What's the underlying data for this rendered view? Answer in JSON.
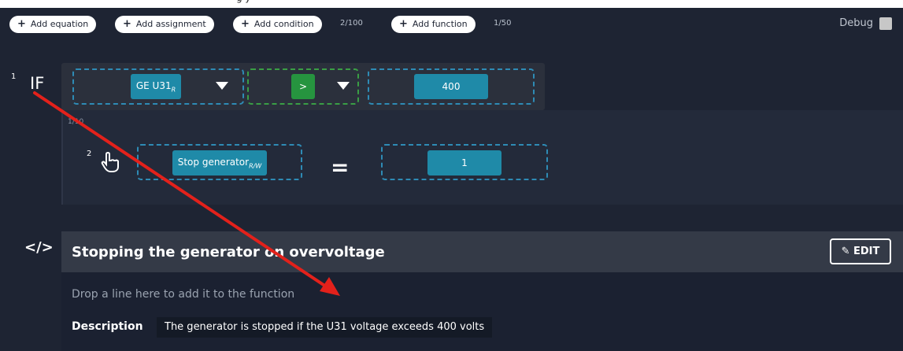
{
  "top_clip_text": "g   y",
  "toolbar": {
    "add_equation": "Add equation",
    "add_assignment": "Add assignment",
    "add_condition": "Add condition",
    "condition_count": "2/100",
    "add_function": "Add function",
    "function_count": "1/50",
    "debug_label": "Debug"
  },
  "condition": {
    "line_number": "1",
    "keyword": "IF",
    "variable": "GE U31",
    "variable_access": "R",
    "operator": ">",
    "value": "400"
  },
  "action": {
    "counter": "1/10",
    "line_number": "2",
    "target": "Stop generator",
    "target_access": "R/W",
    "equals": "=",
    "value": "1"
  },
  "function": {
    "icon_glyph": "</>",
    "title": "Stopping the generator on overvoltage",
    "edit_label": "EDIT",
    "drop_hint": "Drop a line here to add it to the function",
    "description_label": "Description",
    "description_value": "The generator is stopped if the U31 voltage exceeds 400 volts"
  },
  "colors": {
    "background": "#1e2433",
    "accent_teal": "#1f8aa8",
    "accent_green": "#26943f",
    "annotation_arrow": "#e3211b"
  }
}
